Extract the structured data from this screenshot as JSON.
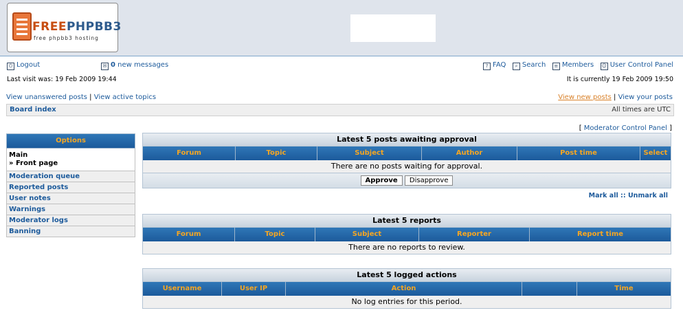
{
  "header": {
    "logo_text_a": "FREE",
    "logo_text_b": "PHPBB3",
    "logo_tagline": "free phpbb3 hosting"
  },
  "nav": {
    "logout": "Logout",
    "new_count": "0",
    "new_messages": "new messages",
    "faq": "FAQ",
    "search": "Search",
    "members": "Members",
    "ucp": "User Control Panel"
  },
  "info": {
    "last_visit": "Last visit was: 19 Feb 2009 19:44",
    "current_time": "It is currently 19 Feb 2009 19:50"
  },
  "links": {
    "unanswered": "View unanswered posts",
    "active": "View active topics",
    "new_posts": "View new posts",
    "your_posts": "View your posts",
    "sep": "|"
  },
  "breadcrumb": {
    "board_index": "Board index",
    "timezone": "All times are UTC"
  },
  "mcp_link": {
    "open": "[",
    "label": "Moderator Control Panel",
    "close": "]"
  },
  "sidebar": {
    "title": "Options",
    "selected": [
      "Main",
      "» Front page"
    ],
    "items": [
      {
        "label": "Moderation queue"
      },
      {
        "label": "Reported posts"
      },
      {
        "label": "User notes"
      },
      {
        "label": "Warnings"
      },
      {
        "label": "Moderator logs"
      },
      {
        "label": "Banning"
      }
    ]
  },
  "approval": {
    "title": "Latest 5 posts awaiting approval",
    "columns": [
      "Forum",
      "Topic",
      "Subject",
      "Author",
      "Post time",
      "Select"
    ],
    "empty": "There are no posts waiting for approval.",
    "approve": "Approve",
    "disapprove": "Disapprove",
    "mark_all": "Mark all",
    "mark_sep": "::",
    "unmark_all": "Unmark all"
  },
  "reports": {
    "title": "Latest 5 reports",
    "columns": [
      "Forum",
      "Topic",
      "Subject",
      "Reporter",
      "Report time"
    ],
    "empty": "There are no reports to review."
  },
  "logs": {
    "title": "Latest 5 logged actions",
    "columns": [
      "Username",
      "User IP",
      "Action",
      "",
      "Time"
    ],
    "empty": "No log entries for this period."
  },
  "colors": {
    "link": "#1c5a9b",
    "header_gradient": "#1c5a9b",
    "header_text": "#f5a623",
    "highlight_link": "#d9822b"
  }
}
